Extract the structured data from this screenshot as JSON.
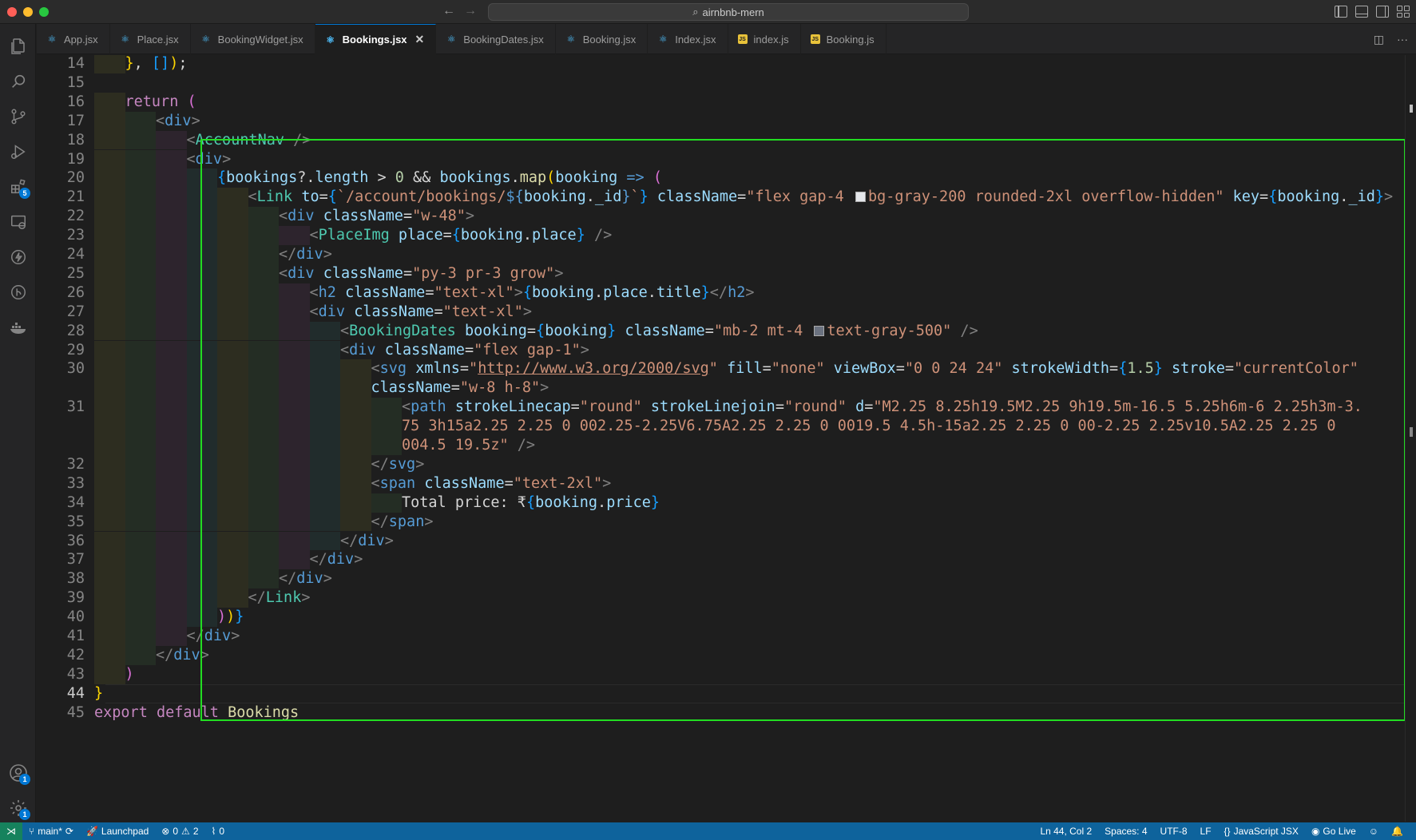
{
  "window": {
    "search_text": "airnbnb-mern",
    "search_icon": "search-icon"
  },
  "activity_bar": {
    "items": [
      {
        "name": "explorer",
        "icon": "files-icon"
      },
      {
        "name": "search",
        "icon": "search-icon"
      },
      {
        "name": "source-control",
        "icon": "source-control-icon"
      },
      {
        "name": "run-debug",
        "icon": "run-debug-icon"
      },
      {
        "name": "extensions",
        "icon": "extensions-icon",
        "badge": "5"
      },
      {
        "name": "remote-explorer",
        "icon": "remote-explorer-icon"
      },
      {
        "name": "thunder-client",
        "icon": "lightning-icon"
      },
      {
        "name": "gitlens",
        "icon": "gitlens-icon"
      },
      {
        "name": "docker",
        "icon": "docker-icon"
      }
    ],
    "accounts_badge": "1",
    "settings_badge": "1"
  },
  "tabs": [
    {
      "label": "App.jsx",
      "icon": "react",
      "active": false
    },
    {
      "label": "Place.jsx",
      "icon": "react",
      "active": false
    },
    {
      "label": "BookingWidget.jsx",
      "icon": "react",
      "active": false
    },
    {
      "label": "Bookings.jsx",
      "icon": "react",
      "active": true
    },
    {
      "label": "BookingDates.jsx",
      "icon": "react",
      "active": false
    },
    {
      "label": "Booking.jsx",
      "icon": "react",
      "active": false
    },
    {
      "label": "Index.jsx",
      "icon": "react",
      "active": false
    },
    {
      "label": "index.js",
      "icon": "js",
      "active": false
    },
    {
      "label": "Booking.js",
      "icon": "js",
      "active": false
    }
  ],
  "editor": {
    "current_line": "44",
    "line_numbers": [
      "14",
      "15",
      "16",
      "17",
      "18",
      "19",
      "20",
      "21",
      "22",
      "23",
      "24",
      "25",
      "26",
      "27",
      "28",
      "29",
      "30",
      "31",
      "32",
      "33",
      "34",
      "35",
      "36",
      "37",
      "38",
      "39",
      "40",
      "41",
      "42",
      "43",
      "44",
      "45"
    ]
  },
  "status_bar": {
    "branch": "main*",
    "launchpad": "Launchpad",
    "errors": "0",
    "warnings": "2",
    "ports": "0",
    "cursor": "Ln 44, Col 2",
    "spaces": "Spaces: 4",
    "encoding": "UTF-8",
    "eol": "LF",
    "language": "JavaScript JSX",
    "golive": "Go Live"
  },
  "colors": {
    "highlight_box": "#22dd22",
    "status_bar": "#0e639c",
    "accent": "#0078d4"
  }
}
